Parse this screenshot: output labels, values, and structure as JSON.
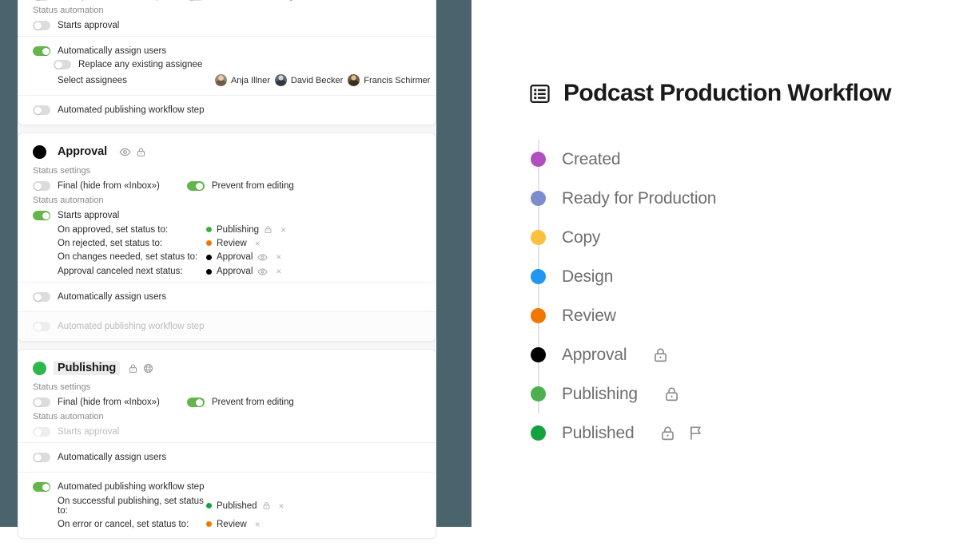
{
  "theme": {
    "accent_green": "#64b64a",
    "backdrop": "#4a646d",
    "page_bg": "#f7f7f7",
    "card_bg": "#ffffff",
    "muted_text": "#8a8a8a"
  },
  "labels": {
    "status_settings": "Status settings",
    "status_automation": "Status automation",
    "final_hide": "Final (hide from «Inbox»)",
    "prevent_editing": "Prevent from editing",
    "starts_approval": "Starts approval",
    "auto_assign": "Automatically assign users",
    "replace_assignee": "Replace any existing assignee",
    "select_assignees": "Select assignees",
    "auto_publish_step": "Automated publishing workflow step",
    "remove": "×"
  },
  "cards": [
    {
      "id": "partial-top-card",
      "title": null,
      "dot_color": null,
      "settings": {
        "final_hide": false,
        "prevent_editing": false
      },
      "automation": {
        "starts_approval": false,
        "starts_approval_disabled": false,
        "rules": []
      },
      "assign": {
        "enabled": true,
        "replace_existing": false,
        "assignees": [
          {
            "name": "Anja Illner",
            "avatar": "avatar-anja"
          },
          {
            "name": "David Becker",
            "avatar": "avatar-david"
          },
          {
            "name": "Francis Schirmer",
            "avatar": "avatar-francis"
          }
        ]
      },
      "publish_step": {
        "enabled": false,
        "disabled": false,
        "rules": []
      }
    },
    {
      "id": "approval-card",
      "title": "Approval",
      "title_highlight": false,
      "dot_color": "#000000",
      "header_icons": [
        "eye-icon",
        "lock-icon"
      ],
      "settings": {
        "final_hide": false,
        "prevent_editing": true
      },
      "automation": {
        "starts_approval": true,
        "starts_approval_disabled": false,
        "rules": [
          {
            "label": "On approved, set status to:",
            "status": "Publishing",
            "dot": "#3fae3f",
            "icons": [
              "lock-icon"
            ]
          },
          {
            "label": "On rejected, set status to:",
            "status": "Review",
            "dot": "#f07800",
            "icons": []
          },
          {
            "label": "On changes needed, set status to:",
            "status": "Approval",
            "dot": "#000000",
            "icons": [
              "eye-icon"
            ]
          },
          {
            "label": "Approval canceled next status:",
            "status": "Approval",
            "dot": "#000000",
            "icons": [
              "eye-icon"
            ]
          }
        ]
      },
      "assign": {
        "enabled": false,
        "assignees": []
      },
      "publish_step": {
        "enabled": false,
        "disabled": true,
        "rules": []
      }
    },
    {
      "id": "publishing-card",
      "title": "Publishing",
      "title_highlight": true,
      "dot_color": "#2eb84c",
      "header_icons": [
        "lock-icon",
        "globe-icon"
      ],
      "settings": {
        "final_hide": false,
        "prevent_editing": true
      },
      "automation": {
        "starts_approval": false,
        "starts_approval_disabled": true,
        "rules": []
      },
      "assign": {
        "enabled": false,
        "assignees": []
      },
      "publish_step": {
        "enabled": true,
        "disabled": false,
        "rules": [
          {
            "label": "On successful publishing, set status to:",
            "status": "Published",
            "dot": "#12a23e",
            "icons": [
              "lock-icon"
            ]
          },
          {
            "label": "On error or cancel, set status to:",
            "status": "Review",
            "dot": "#f07800",
            "icons": []
          }
        ]
      }
    }
  ],
  "workflow": {
    "icon": "list-view-icon",
    "title": "Podcast Production Workflow",
    "statuses": [
      {
        "label": "Created",
        "color": "#b martin",
        "dot": "#b24fc0",
        "icons": []
      },
      {
        "label": "Ready for Production",
        "dot": "#7d8ccc",
        "icons": []
      },
      {
        "label": "Copy",
        "dot": "#fbc040",
        "icons": []
      },
      {
        "label": "Design",
        "dot": "#2196f3",
        "icons": []
      },
      {
        "label": "Review",
        "dot": "#f07800",
        "icons": []
      },
      {
        "label": "Approval",
        "dot": "#000000",
        "icons": [
          "lock-icon"
        ]
      },
      {
        "label": "Publishing",
        "dot": "#4caf50",
        "icons": [
          "lock-icon"
        ]
      },
      {
        "label": "Published",
        "dot": "#12a23e",
        "icons": [
          "lock-icon",
          "flag-icon"
        ]
      }
    ]
  }
}
